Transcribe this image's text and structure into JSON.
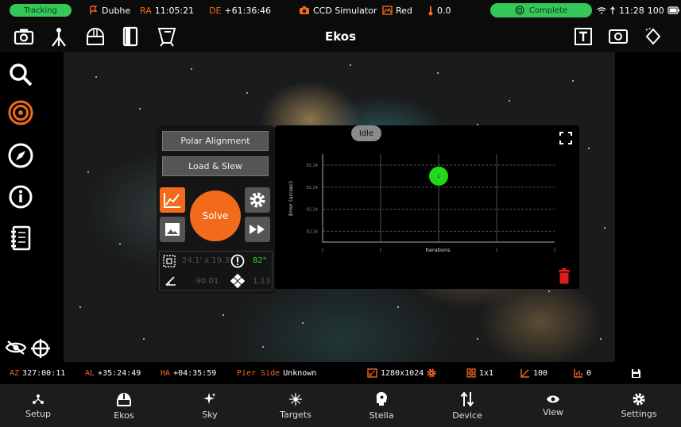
{
  "status_bar": {
    "tracking": "Tracking",
    "target": "Dubhe",
    "ra_label": "RA",
    "ra_value": "11:05:21",
    "de_label": "DE",
    "de_value": "+61:36:46",
    "camera": "CCD Simulator",
    "filter": "Red",
    "temperature": "0.0",
    "complete": "Complete",
    "clock": "11:28",
    "battery": "100"
  },
  "toolbar": {
    "title": "Ekos"
  },
  "align_panel": {
    "polar_alignment_label": "Polar Alignment",
    "load_slew_label": "Load & Slew",
    "solve_label": "Solve",
    "fov": "24.1' x 19.3'",
    "rotation": "-90.01",
    "error": "82\"",
    "pixscale": "1.13"
  },
  "chart_panel": {
    "status": "Idle"
  },
  "chart_data": {
    "type": "scatter",
    "xlabel": "Iterations",
    "ylabel": "Error (arcsec)",
    "x_ticks": [
      "1",
      "1",
      "1",
      "1",
      "1"
    ],
    "y_ticks": [
      "82.24",
      "82.24",
      "82.24",
      "82.24"
    ],
    "points": [
      {
        "x": 3,
        "y": 82.24,
        "label": "1"
      }
    ],
    "grid": true
  },
  "info_bar": {
    "az_label": "AZ",
    "az_value": "327:00:11",
    "al_label": "AL",
    "al_value": "+35:24:49",
    "ha_label": "HA",
    "ha_value": "+04:35:59",
    "pier_label": "Pier Side",
    "pier_value": "Unknown",
    "resolution": "1280x1024",
    "binning": "1x1",
    "gain": "100",
    "offset": "0"
  },
  "bottom_nav": [
    {
      "label": "Setup"
    },
    {
      "label": "Ekos"
    },
    {
      "label": "Sky"
    },
    {
      "label": "Targets"
    },
    {
      "label": "Stella"
    },
    {
      "label": "Device"
    },
    {
      "label": "View"
    },
    {
      "label": "Settings"
    }
  ],
  "colors": {
    "accent": "#f26a1c",
    "status_green": "#36c75a",
    "point_green": "#22d81a"
  }
}
